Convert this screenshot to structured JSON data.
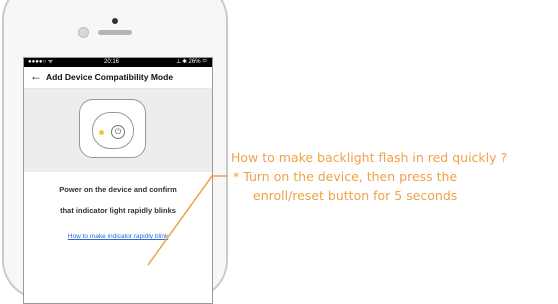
{
  "status_bar": {
    "signal": "●●●●○ ᯤ",
    "time": "20:16",
    "right": "⟂ ✱ 26% ▭"
  },
  "nav": {
    "back_icon": "←",
    "title": "Add Device Compatibility Mode"
  },
  "device_illustration": {
    "power_symbol": "⏻",
    "led_color": "#f2cc23"
  },
  "instructions": {
    "line1": "Power on the device and confirm",
    "line2": "that indicator light rapidly blinks"
  },
  "help_link": "How to make indicator rapidly blink",
  "annotation": {
    "question": "How to make backlight flash in red quickly ?",
    "answer_line1": "* Turn on the device, then press the",
    "answer_line2": "enroll/reset button for 5 seconds",
    "color": "#f0a246"
  }
}
